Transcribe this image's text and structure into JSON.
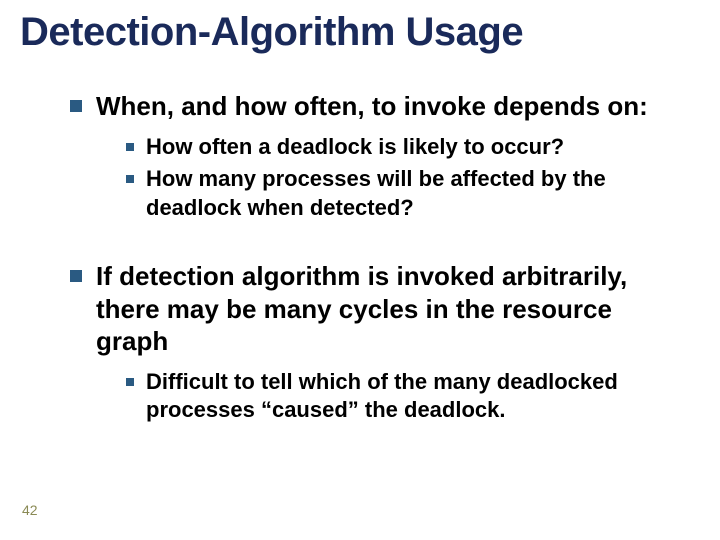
{
  "title": "Detection-Algorithm Usage",
  "page_number": "42",
  "bullets": [
    {
      "text": "When, and how often, to invoke depends on:",
      "sub": [
        "How often a deadlock is likely to occur?",
        "How many processes will be affected by the deadlock when detected?"
      ]
    },
    {
      "text": "If detection algorithm is invoked arbitrarily, there may be many cycles in the resource graph",
      "sub": [
        "Difficult to tell which of the many deadlocked processes “caused” the deadlock."
      ]
    }
  ]
}
